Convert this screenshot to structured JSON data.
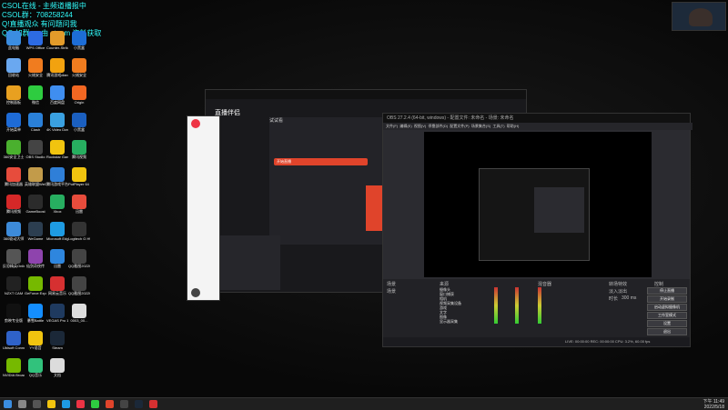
{
  "overlay": {
    "lines": [
      "CSOL在线 - 主频道播报中",
      "CSOL群：708258244",
      "Q!直播观众 有问题问我",
      "QQ 加群 — 由 steam 资料获取 "
    ]
  },
  "desktop_icons": [
    {
      "label": "此电脑",
      "color": "#3b8de0"
    },
    {
      "label": "WPS Office",
      "color": "#2d6be3"
    },
    {
      "label": "Counter-Strike Global Off...",
      "color": "#e29b2a"
    },
    {
      "label": "小黑盒",
      "color": "#1d6dd6"
    },
    {
      "label": "回收站",
      "color": "#6aa8f0"
    },
    {
      "label": "火绒安全",
      "color": "#f07c1f"
    },
    {
      "label": "腾讯游戏dian",
      "color": "#f2a20f"
    },
    {
      "label": "火绒安全",
      "color": "#f07c1f"
    },
    {
      "label": "控制面板",
      "color": "#e8a020"
    },
    {
      "label": "微信",
      "color": "#2ecc40"
    },
    {
      "label": "百度网盘",
      "color": "#3f8ef0"
    },
    {
      "label": "Origin",
      "color": "#f26722"
    },
    {
      "label": "开始菜单",
      "color": "#1e6bd6"
    },
    {
      "label": "Clash",
      "color": "#2a80d8"
    },
    {
      "label": "4K Video Download...",
      "color": "#3aa0e0"
    },
    {
      "label": "小黑盒",
      "color": "#1b5fbf"
    },
    {
      "label": "360安全卫士",
      "color": "#4ab02e"
    },
    {
      "label": "OBS Studio",
      "color": "#444"
    },
    {
      "label": "Rockstar Games...",
      "color": "#f1c40f"
    },
    {
      "label": "腾讯视频",
      "color": "#27ae60"
    },
    {
      "label": "腾讯加速器",
      "color": "#e74c3c"
    },
    {
      "label": "英雄联盟WeGame",
      "color": "#c29b4a"
    },
    {
      "label": "腾讯游戏平台",
      "color": "#2f7fd8"
    },
    {
      "label": "PotPlayer 64 bit",
      "color": "#f1c40f"
    },
    {
      "label": "腾讯视频",
      "color": "#d62828"
    },
    {
      "label": "GameBoost",
      "color": "#2b2b2b"
    },
    {
      "label": "Xbox",
      "color": "#27ae60"
    },
    {
      "label": "迅雷",
      "color": "#e74c3c"
    },
    {
      "label": "360驱动大师",
      "color": "#3d8bd9"
    },
    {
      "label": "WeGame",
      "color": "#2c3e50"
    },
    {
      "label": "Microsoft Edge",
      "color": "#1e9be3"
    },
    {
      "label": "Logitech G HUB",
      "color": "#333"
    },
    {
      "label": "反恐精英Online",
      "color": "#555"
    },
    {
      "label": "仙剑奇侠传",
      "color": "#8e44ad"
    },
    {
      "label": "迅雷",
      "color": "#2e86de"
    },
    {
      "label": "QQ截图20220...",
      "color": "#444"
    },
    {
      "label": "NZXT CAM",
      "color": "#222"
    },
    {
      "label": "GeForce Experience",
      "color": "#76b900"
    },
    {
      "label": "网易云音乐",
      "color": "#d63031"
    },
    {
      "label": "QQ截图20220...",
      "color": "#444"
    },
    {
      "label": "剪映专业版",
      "color": "#111"
    },
    {
      "label": "暴雪Battle",
      "color": "#148eff"
    },
    {
      "label": "VEGAS Pro 19.0",
      "color": "#1f3a5f"
    },
    {
      "label": "0003_00...",
      "color": "#ddd"
    },
    {
      "label": "Ubisoft Connect",
      "color": "#2f62c8"
    },
    {
      "label": "YY语音",
      "color": "#f1c40f"
    },
    {
      "label": "Steam",
      "color": "#1b2838"
    },
    {
      "label": "",
      "color": "#00000000"
    },
    {
      "label": "NVIDIA Broadcast",
      "color": "#76b900"
    },
    {
      "label": "QQ音乐",
      "color": "#31c27c"
    },
    {
      "label": "文档",
      "color": "#dcdcdc"
    }
  ],
  "obs": {
    "title": "OBS 27.2.4 (64-bit, windows) - 配置文件: 未命名 - 场景: 未命名",
    "menu": [
      "文件(F)",
      "编辑(E)",
      "视图(V)",
      "停靠部件(D)",
      "配置文件(P)",
      "场景集合(S)",
      "工具(T)",
      "帮助(H)"
    ],
    "scenes_header": "场景",
    "sources_header": "来源",
    "mixer_header": "混音器",
    "transitions_header": "转场特效",
    "controls_header": "控制",
    "scene_list": [
      "场景"
    ],
    "source_list": [
      "摄像头",
      "窗口捕获",
      "相机",
      "视频采集设备",
      "游戏",
      "文字",
      "图像",
      "显示器采集"
    ],
    "controls": [
      "停止直播",
      "开始录制",
      "启动虚拟摄像机",
      "工作室模式",
      "设置",
      "退出"
    ],
    "transition_value": "淡入淡出",
    "duration_label": "时长",
    "duration_value": "300 ms",
    "status": "LIVE: 00:00:00  REC: 00:00:00  CPU: 3.2%, 60.00 fps"
  },
  "qq_app": {
    "title": "直播伴侣",
    "tab_active": "试试看",
    "red_button": "开始直播"
  },
  "taskbar": {
    "time": "下午 11:49",
    "date": "2022/5/18"
  },
  "colors": {
    "accent": "#e0442b",
    "obs_bg": "#2b2b30",
    "taskbar": "#1f1f1f"
  }
}
